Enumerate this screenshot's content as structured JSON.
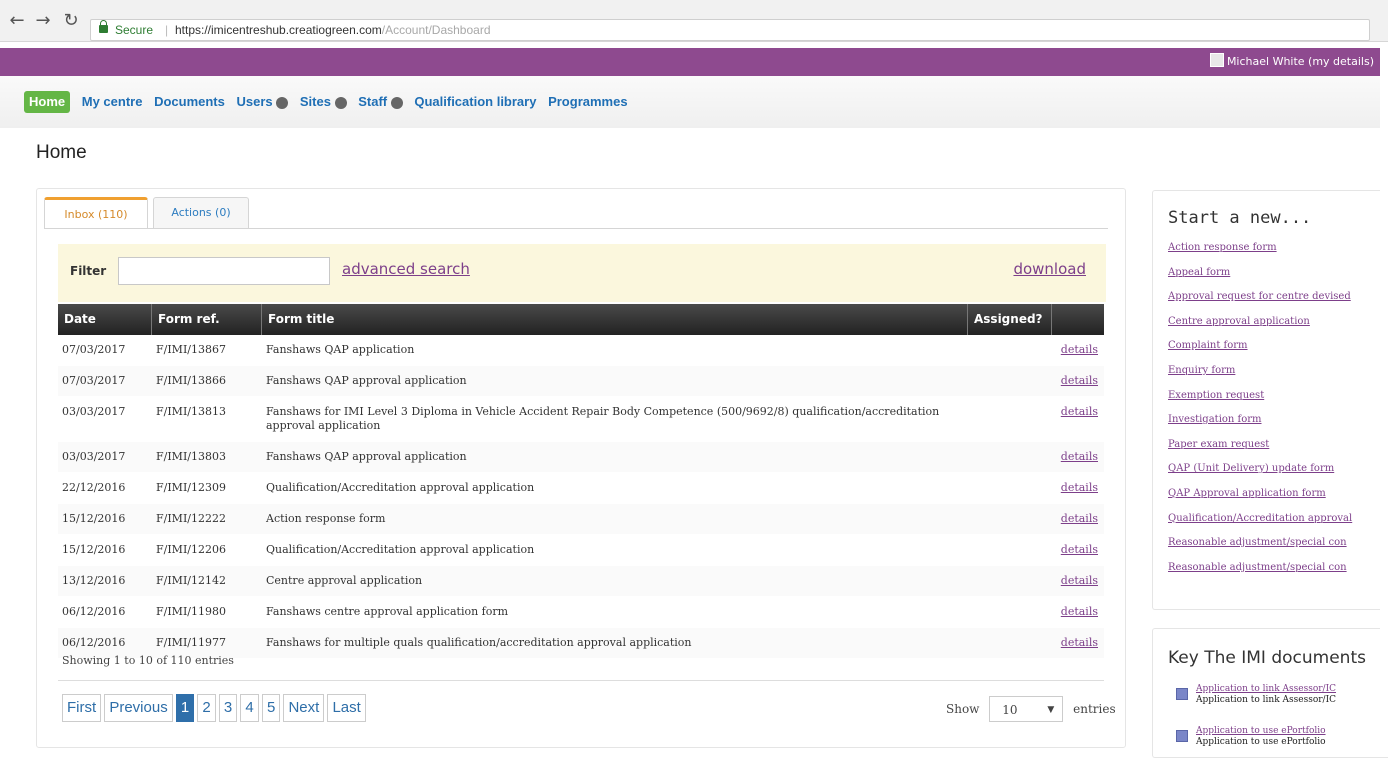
{
  "browser": {
    "secure_label": "Secure",
    "url_host": "https://imicentreshub.creatiogreen.com",
    "url_path": "/Account/Dashboard"
  },
  "topbar": {
    "user": "Michael White (my details)"
  },
  "nav": {
    "home": "Home",
    "my_centre": "My centre",
    "documents": "Documents",
    "users": "Users",
    "sites": "Sites",
    "staff": "Staff",
    "qualification_library": "Qualification library",
    "programmes": "Programmes"
  },
  "page": {
    "title": "Home"
  },
  "tabs": {
    "inbox": "Inbox (110)",
    "actions": "Actions (0)"
  },
  "filter": {
    "label": "Filter",
    "value": "",
    "advanced_search": "advanced search",
    "download": "download"
  },
  "table": {
    "headers": {
      "date": "Date",
      "ref": "Form ref.",
      "title": "Form title",
      "assigned": "Assigned?"
    },
    "details_label": "details",
    "rows": [
      {
        "date": "07/03/2017",
        "ref": "F/IMI/13867",
        "title": "Fanshaws QAP application"
      },
      {
        "date": "07/03/2017",
        "ref": "F/IMI/13866",
        "title": "Fanshaws QAP approval application"
      },
      {
        "date": "03/03/2017",
        "ref": "F/IMI/13813",
        "title": "Fanshaws for IMI Level 3 Diploma in Vehicle Accident Repair Body Competence (500/9692/8) qualification/accreditation approval application"
      },
      {
        "date": "03/03/2017",
        "ref": "F/IMI/13803",
        "title": "Fanshaws QAP approval application"
      },
      {
        "date": "22/12/2016",
        "ref": "F/IMI/12309",
        "title": "Qualification/Accreditation approval application"
      },
      {
        "date": "15/12/2016",
        "ref": "F/IMI/12222",
        "title": "Action response form"
      },
      {
        "date": "15/12/2016",
        "ref": "F/IMI/12206",
        "title": "Qualification/Accreditation approval application"
      },
      {
        "date": "13/12/2016",
        "ref": "F/IMI/12142",
        "title": "Centre approval application"
      },
      {
        "date": "06/12/2016",
        "ref": "F/IMI/11980",
        "title": "Fanshaws centre approval application form"
      },
      {
        "date": "06/12/2016",
        "ref": "F/IMI/11977",
        "title": "Fanshaws for multiple quals qualification/accreditation approval application"
      }
    ]
  },
  "showing": "Showing 1 to 10 of 110 entries",
  "pager": {
    "first": "First",
    "previous": "Previous",
    "next": "Next",
    "last": "Last",
    "pages": [
      "1",
      "2",
      "3",
      "4",
      "5"
    ]
  },
  "page_size": {
    "show": "Show",
    "value": "10",
    "entries": "entries"
  },
  "sidebar": {
    "title": "Start a new...",
    "links": [
      "Action response form",
      "Appeal form",
      "Approval request for centre devised",
      "Centre approval application",
      "Complaint form",
      "Enquiry form",
      "Exemption request",
      "Investigation form",
      "Paper exam request",
      "QAP (Unit Delivery) update form",
      "QAP Approval application form",
      "Qualification/Accreditation approval",
      "Reasonable adjustment/special con",
      "Reasonable adjustment/special con"
    ]
  },
  "key_docs": {
    "title": "Key The IMI documents",
    "items": [
      {
        "link": "Application to link Assessor/IC",
        "desc": "Application to link Assessor/IC"
      },
      {
        "link": "Application to use ePortfolio",
        "desc": "Application to use ePortfolio"
      }
    ]
  },
  "colors": {
    "purple_bar": "#8e4a8f",
    "home_active": "#64b646",
    "link_purple": "#7d3f8a",
    "nav_blue": "#1f6fb5"
  }
}
